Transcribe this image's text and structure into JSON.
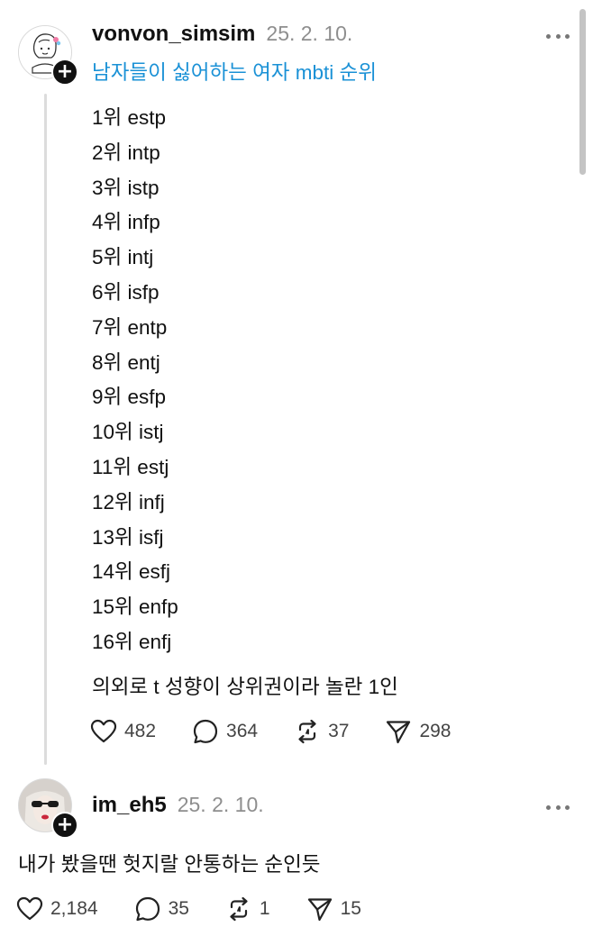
{
  "post": {
    "username": "vonvon_simsim",
    "timestamp": "25. 2. 10.",
    "topic": "남자들이 싫어하는 여자 mbti 순위",
    "rankings": [
      "1위 estp",
      "2위 intp",
      "3위 istp",
      "4위 infp",
      "5위 intj",
      "6위 isfp",
      "7위 entp",
      "8위 entj",
      "9위 esfp",
      "10위 istj",
      "11위 estj",
      "12위 infj",
      "13위 isfj",
      "14위 esfj",
      "15위 enfp",
      "16위 enfj"
    ],
    "comment": "의외로 t 성향이 상위권이라 놀란 1인",
    "likes": "482",
    "replies": "364",
    "reposts": "37",
    "shares": "298"
  },
  "reply": {
    "username": "im_eh5",
    "timestamp": "25. 2. 10.",
    "text": "내가 봤을땐 헛지랄 안통하는 순인듯",
    "likes": "2,184",
    "replies": "35",
    "reposts": "1",
    "shares": "15"
  },
  "icons": {
    "like": "heart-icon",
    "reply": "speech-bubble-icon",
    "repost": "repost-arrows-icon",
    "share": "paper-plane-icon",
    "more": "more-dots-icon",
    "follow": "plus-icon"
  },
  "colors": {
    "topic": "#1a91d6",
    "text": "#111111",
    "muted": "#8e8e8e"
  }
}
